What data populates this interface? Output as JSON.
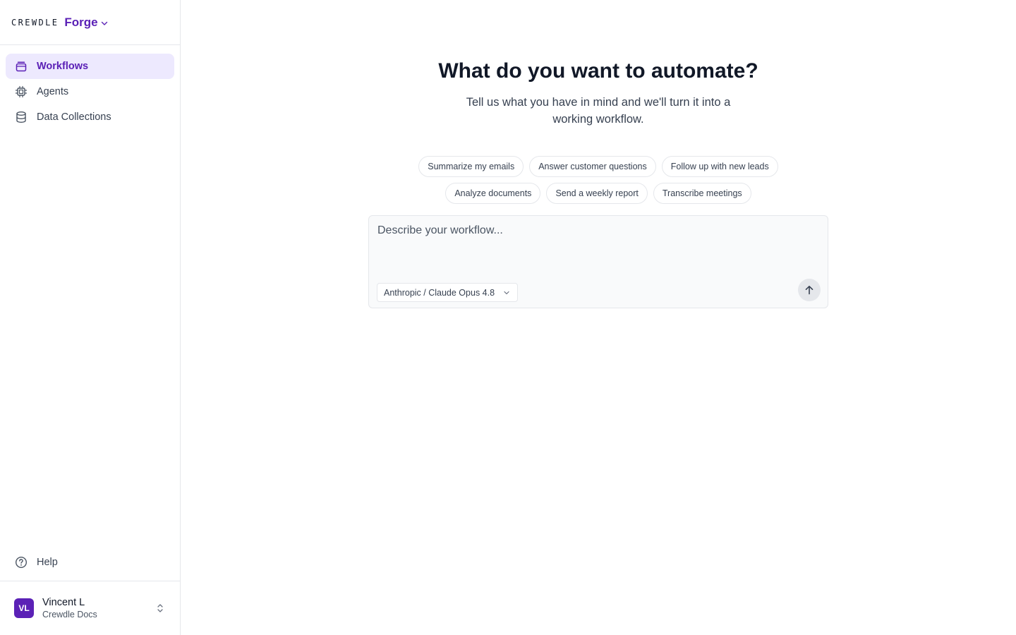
{
  "brand": {
    "logo": "CREWDLE",
    "product": "Forge"
  },
  "sidebar": {
    "items": [
      {
        "label": "Workflows",
        "icon": "workflow-icon",
        "active": true
      },
      {
        "label": "Agents",
        "icon": "chip-icon",
        "active": false
      },
      {
        "label": "Data Collections",
        "icon": "database-icon",
        "active": false
      }
    ],
    "help_label": "Help"
  },
  "user": {
    "initials": "VL",
    "name": "Vincent L",
    "org": "Crewdle Docs"
  },
  "main": {
    "title": "What do you want to automate?",
    "subtitle": "Tell us what you have in mind and we'll turn it into a working workflow.",
    "chips_row1": [
      "Summarize my emails",
      "Answer customer questions",
      "Follow up with new leads"
    ],
    "chips_row2": [
      "Analyze documents",
      "Send a weekly report",
      "Transcribe meetings"
    ],
    "composer": {
      "placeholder": "Describe your workflow...",
      "model": "Anthropic / Claude Opus 4.8"
    }
  },
  "colors": {
    "accent": "#5b21b6",
    "active_bg": "#ede9fe",
    "border": "#e5e7eb"
  }
}
